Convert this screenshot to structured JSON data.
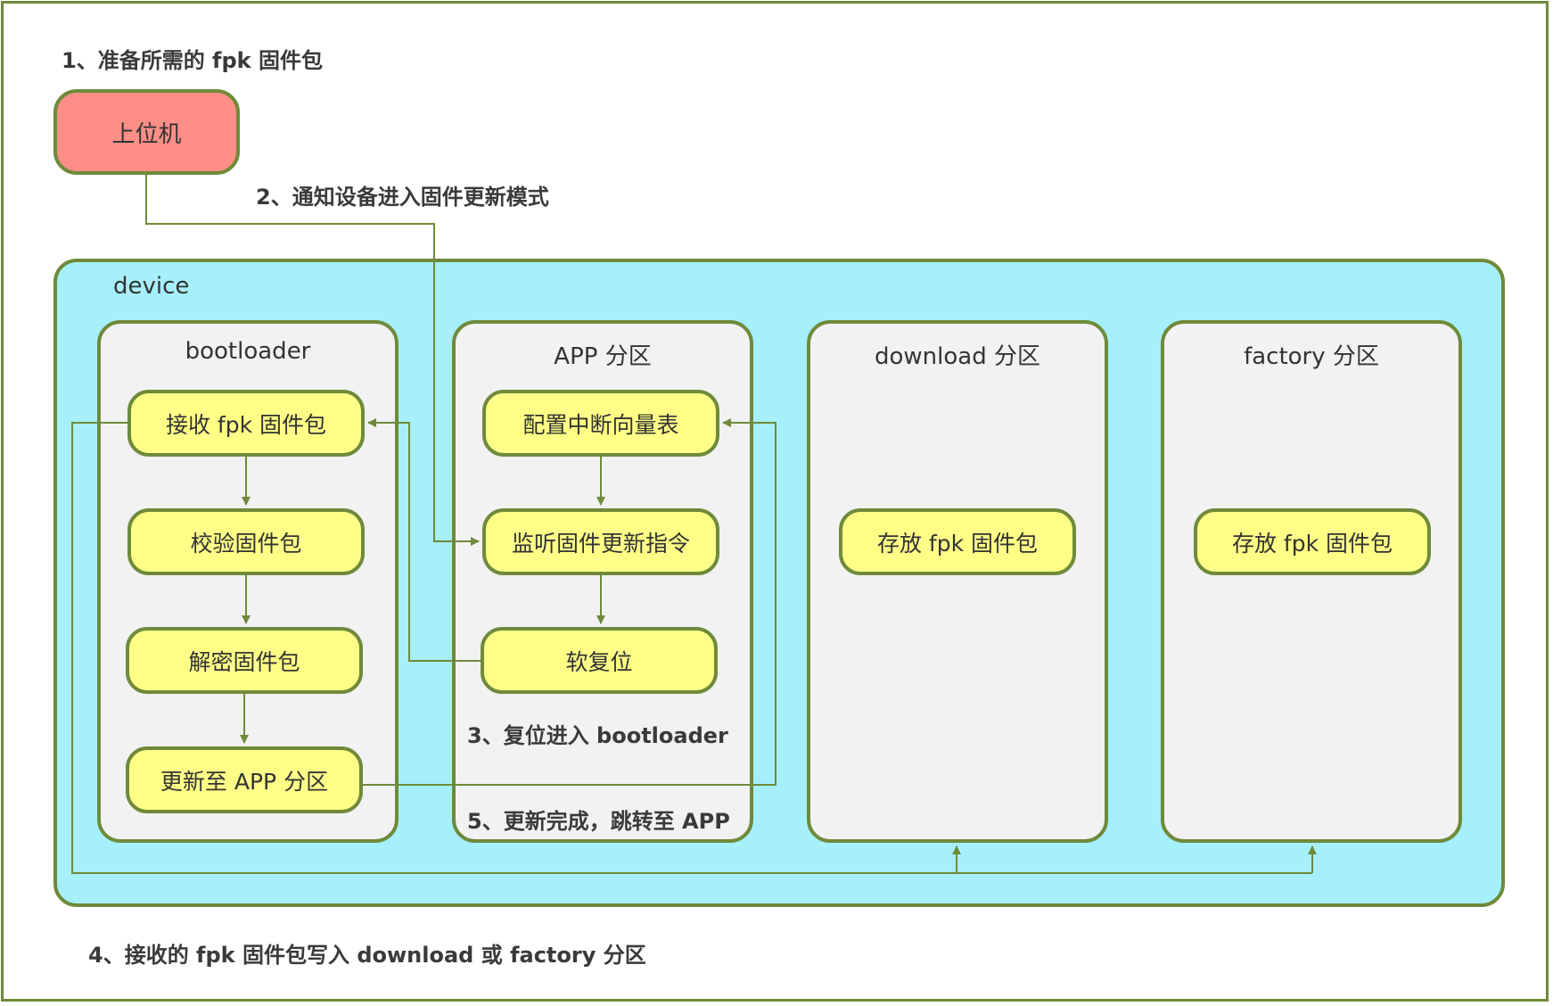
{
  "steps": {
    "s1": "1、准备所需的 fpk 固件包",
    "s2": "2、通知设备进入固件更新模式",
    "s3": "3、复位进入 bootloader",
    "s4": "4、接收的 fpk 固件包写入 download 或 factory 分区",
    "s5": "5、更新完成，跳转至 APP"
  },
  "host": {
    "label": "上位机",
    "color": "#ff8f86"
  },
  "device": {
    "label": "device",
    "color": "#a6f0fc"
  },
  "partitions": {
    "bootloader": {
      "title": "bootloader",
      "nodes": [
        "接收 fpk 固件包",
        "校验固件包",
        "解密固件包",
        "更新至 APP 分区"
      ]
    },
    "app": {
      "title": "APP 分区",
      "nodes": [
        "配置中断向量表",
        "监听固件更新指令",
        "软复位"
      ]
    },
    "download": {
      "title": "download 分区",
      "nodes": [
        "存放 fpk 固件包"
      ]
    },
    "factory": {
      "title": "factory 分区",
      "nodes": [
        "存放 fpk 固件包"
      ]
    }
  },
  "colors": {
    "border": "#6f8a3a",
    "node_fill": "#ffff88",
    "partition_fill": "#f2f2f2"
  }
}
